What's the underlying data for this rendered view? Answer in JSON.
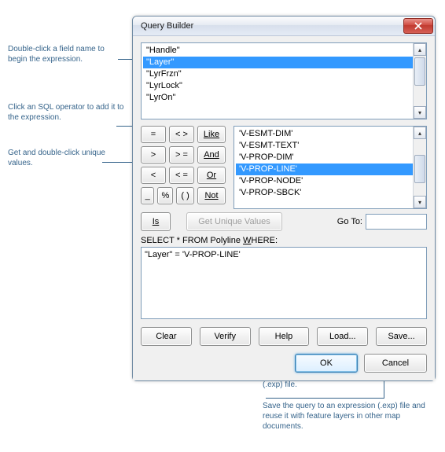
{
  "window": {
    "title": "Query Builder"
  },
  "fields": {
    "items": [
      "\"Handle\"",
      "\"Layer\"",
      "\"LyrFrzn\"",
      "\"LyrLock\"",
      "\"LyrOn\""
    ],
    "selected_index": 1
  },
  "operators": {
    "eq": "=",
    "ne": "< >",
    "like": "Like",
    "gt": ">",
    "ge": "> =",
    "and": "And",
    "lt": "<",
    "le": "< =",
    "or": "Or",
    "uscore": "_",
    "pct": "%",
    "paren": "( )",
    "not": "Not",
    "is": "Is"
  },
  "values": {
    "items": [
      "'V-ESMT-DIM'",
      "'V-ESMT-TEXT'",
      "'V-PROP-DIM'",
      "'V-PROP-LINE'",
      "'V-PROP-NODE'",
      "'V-PROP-SBCK'"
    ],
    "selected_index": 3
  },
  "get_unique": "Get Unique Values",
  "goto_label": "Go To:",
  "goto_value": "",
  "select_prefix": "SELECT * FROM Polyline ",
  "select_where_letter": "W",
  "select_where_suffix": "HERE:",
  "expression": "\"Layer\" = 'V-PROP-LINE'",
  "buttons": {
    "clear": "Clear",
    "verify": "Verify",
    "help": "Help",
    "load": "Load...",
    "save": "Save...",
    "ok": "OK",
    "cancel": "Cancel"
  },
  "annotations": {
    "a1": "Double-click a field name to begin the expression.",
    "a2": "Click an SQL operator to add it to the expression.",
    "a3": "Get and double-click unique values.",
    "a4": "Load an existing expression (.exp) file.",
    "a5": "Save the query to an expression (.exp) file and reuse it with feature layers in other map documents."
  }
}
